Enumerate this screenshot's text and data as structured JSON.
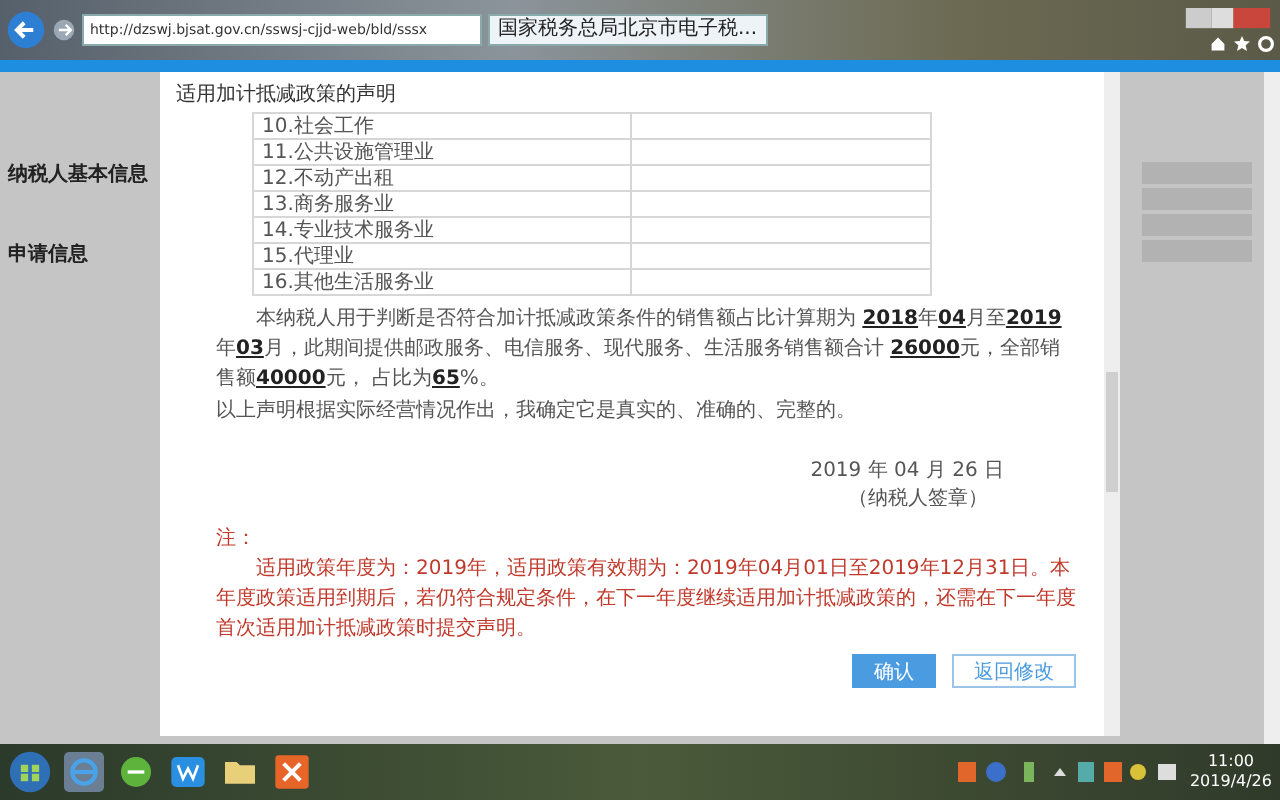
{
  "browser": {
    "address": "http://dzswj.bjsat.gov.cn/sswsj-cjjd-web/bld/sssx",
    "tab": "国家税务总局北京市电子税..."
  },
  "page": {
    "sections": [
      "纳税人基本信息",
      "申请信息"
    ]
  },
  "dialog": {
    "title": "适用加计抵减政策的声明",
    "industry_rows": [
      "10.社会工作",
      "11.公共设施管理业",
      "12.不动产出租",
      "13.商务服务业",
      "14.专业技术服务业",
      "15.代理业",
      "16.其他生活服务业"
    ],
    "statement": [
      {
        "text": "本纳税人用于判断是否符合加计抵减政策条件的销售额占比计算期为 ",
        "kind": "plain"
      },
      {
        "text": "2018",
        "kind": "filled"
      },
      {
        "text": "年",
        "kind": "plain"
      },
      {
        "text": "04",
        "kind": "filled"
      },
      {
        "text": "月至",
        "kind": "plain"
      },
      {
        "text": "2019",
        "kind": "filled"
      },
      {
        "text": "年",
        "kind": "plain"
      },
      {
        "text": "03",
        "kind": "filled"
      },
      {
        "text": "月，此期间提供邮政服务、电信服务、现代服务、生活服务销售额合计 ",
        "kind": "plain"
      },
      {
        "text": "26000",
        "kind": "filled"
      },
      {
        "text": "元，全部销售额",
        "kind": "plain"
      },
      {
        "text": "40000",
        "kind": "filled"
      },
      {
        "text": "元， 占比为",
        "kind": "plain"
      },
      {
        "text": "65",
        "kind": "filled"
      },
      {
        "text": "%。",
        "kind": "plain"
      }
    ],
    "declaration": "以上声明根据实际经营情况作出，我确定它是真实的、准确的、完整的。",
    "date": "2019 年 04 月 26 日",
    "signature": "（纳税人签章）",
    "note_label": "注：",
    "note": "适用政策年度为：2019年，适用政策有效期为：2019年04月01日至2019年12月31日。本年度政策适用到期后，若仍符合规定条件，在下一年度继续适用加计抵减政策的，还需在下一年度首次适用加计抵减政策时提交声明。",
    "buttons": [
      {
        "label": "确认",
        "kind": "primary"
      },
      {
        "label": "返回修改",
        "kind": "secondary"
      }
    ]
  },
  "taskbar": {
    "time": "11:00",
    "date": "2019/4/26"
  }
}
